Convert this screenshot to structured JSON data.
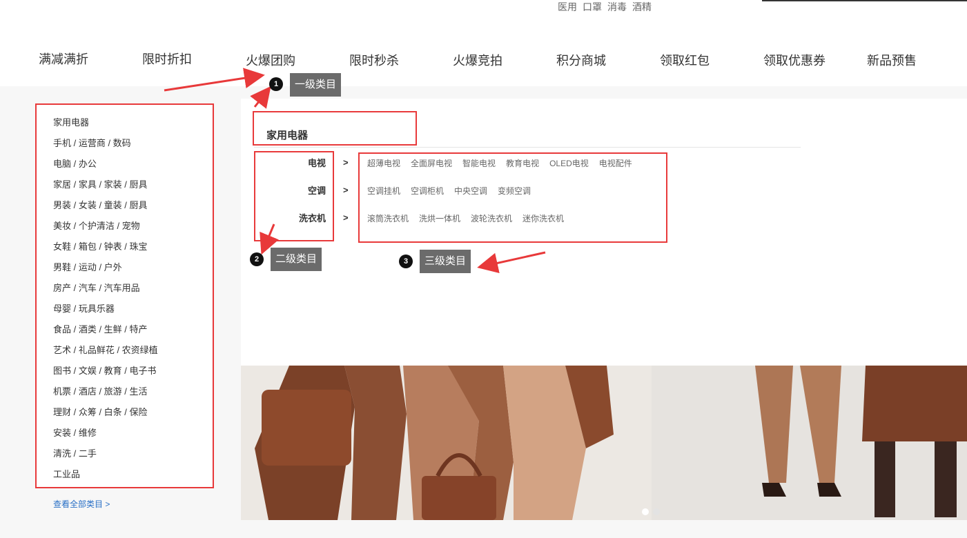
{
  "header": {
    "hot_words": [
      "医用",
      "口罩",
      "消毒",
      "酒精"
    ]
  },
  "nav": {
    "items": [
      "满减满折",
      "限时折扣",
      "火爆团购",
      "限时秒杀",
      "火爆竞拍",
      "积分商城",
      "领取红包",
      "领取优惠券",
      "新品预售"
    ]
  },
  "categories": {
    "items": [
      "家用电器",
      "手机 / 运营商 / 数码",
      "电脑 / 办公",
      "家居 / 家具 / 家装 / 厨具",
      "男装 / 女装 / 童装 / 厨具",
      "美妆 / 个护清洁 / 宠物",
      "女鞋 / 箱包 / 钟表 / 珠宝",
      "男鞋 / 运动 / 户外",
      "房产 / 汽车 / 汽车用品",
      "母婴 / 玩具乐器",
      "食品 / 酒类 / 生鲜 / 特产",
      "艺术 / 礼品鲜花 / 农资绿植",
      "图书 / 文娱 / 教育 / 电子书",
      "机票 / 酒店 / 旅游 / 生活",
      "理财 / 众筹 / 白条 / 保险",
      "安装 / 维修",
      "清洗 / 二手",
      "工业品"
    ],
    "view_all": "查看全部类目 >"
  },
  "flyout": {
    "title": "家用电器",
    "arrow": ">",
    "groups": [
      {
        "label": "电视",
        "items": [
          "超薄电视",
          "全面屏电视",
          "智能电视",
          "教育电视",
          "OLED电视",
          "电视配件"
        ]
      },
      {
        "label": "空调",
        "items": [
          "空调挂机",
          "空调柜机",
          "中央空调",
          "变频空调"
        ]
      },
      {
        "label": "洗衣机",
        "items": [
          "滚筒洗衣机",
          "洗烘一体机",
          "波轮洗衣机",
          "迷你洗衣机"
        ]
      }
    ]
  },
  "annotations": {
    "level1": {
      "num": "1",
      "text": "一级类目"
    },
    "level2": {
      "num": "2",
      "text": "二级类目"
    },
    "level3": {
      "num": "3",
      "text": "三级类目"
    }
  },
  "banner": {
    "slide_count": 2,
    "active_index": 0
  },
  "colors": {
    "annotation_red": "#e8393a",
    "callout_bg": "#6b6b6b",
    "link_blue": "#2a70c6"
  }
}
